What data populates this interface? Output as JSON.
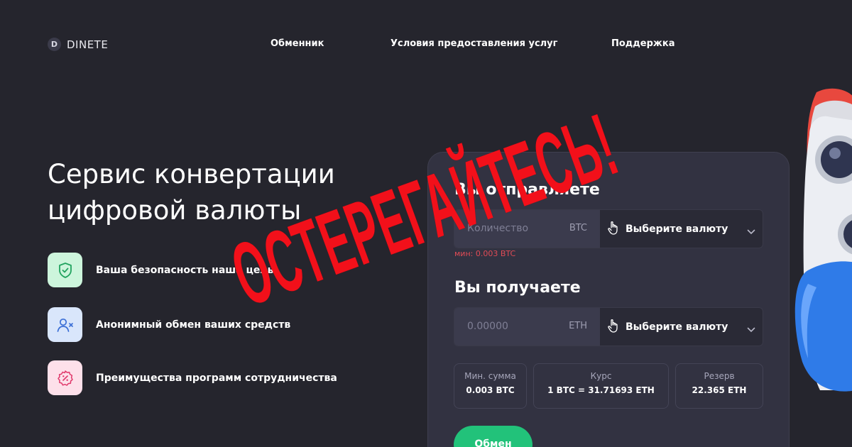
{
  "header": {
    "logo_letter": "D",
    "logo_text": "DINETE",
    "nav": [
      "Обменник",
      "Условия предоставления услуг",
      "Поддержка"
    ]
  },
  "hero": {
    "title": "Сервис конвертации цифровой валюты",
    "features": [
      {
        "label": "Ваша безопасность наша цель",
        "icon": "shield-check-icon"
      },
      {
        "label": "Анонимный обмен ваших средств",
        "icon": "user-anonymous-icon"
      },
      {
        "label": "Преимущества программ сотрудничества",
        "icon": "percent-badge-icon"
      }
    ]
  },
  "exchange": {
    "send_heading": "Вы отправляете",
    "send_placeholder": "Количество",
    "send_currency": "BTC",
    "send_select": "Выберите валюту",
    "min_note": "мин: 0.003 BTC",
    "receive_heading": "Вы получаете",
    "receive_value": "0.00000",
    "receive_currency": "ETH",
    "receive_select": "Выберите валюту",
    "stats": [
      {
        "label": "Мин. сумма",
        "value": "0.003 BTC"
      },
      {
        "label": "Курс",
        "value": "1 BTC = 31.71693 ETH"
      },
      {
        "label": "Резерв",
        "value": "22.365 ETH"
      }
    ],
    "button_label": "Обмен"
  },
  "warning_stamp": "ОСТЕРЕГАЙТЕСЬ!",
  "colors": {
    "background": "#25252d",
    "card": "#323241",
    "accent_green": "#22c27a",
    "error_red": "#e04b55",
    "stamp_red": "#f2101a"
  }
}
